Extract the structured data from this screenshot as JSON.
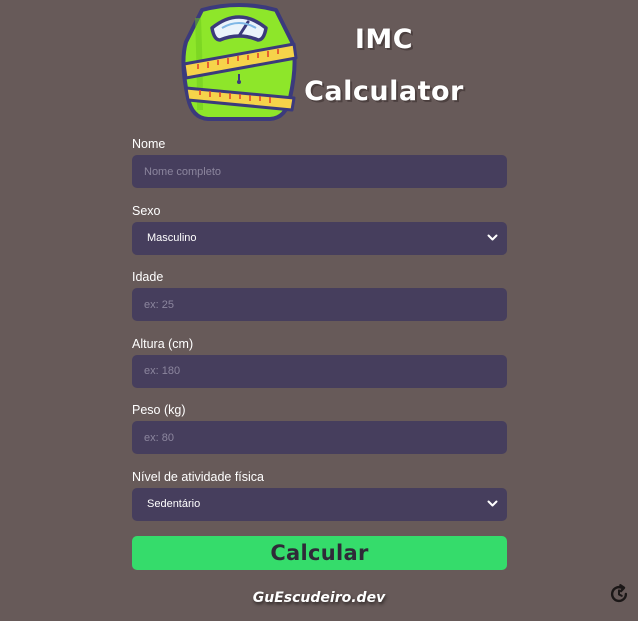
{
  "header": {
    "title_line1": "IMC",
    "title_line2": "Calculator",
    "logo_icon": "scale-with-measuring-tape-icon"
  },
  "form": {
    "name": {
      "label": "Nome",
      "placeholder": "Nome completo",
      "value": ""
    },
    "sex": {
      "label": "Sexo",
      "selected": "Masculino"
    },
    "age": {
      "label": "Idade",
      "placeholder": "ex: 25",
      "value": ""
    },
    "height": {
      "label": "Altura (cm)",
      "placeholder": "ex: 180",
      "value": ""
    },
    "weight": {
      "label": "Peso (kg)",
      "placeholder": "ex: 80",
      "value": ""
    },
    "activity": {
      "label": "Nível de atividade física",
      "selected": "Sedentário"
    }
  },
  "actions": {
    "calculate_label": "Calcular",
    "reset_icon": "refresh-icon"
  },
  "footer": {
    "credit": "GuEscudeiro.dev"
  },
  "colors": {
    "background": "#675a59",
    "input_bg": "#463e5d",
    "button_bg": "#35dc6b",
    "button_text": "#2f2a38",
    "logo_green": "#8ee62a",
    "logo_outline": "#3b3a7c",
    "tape_yellow": "#f6d34a"
  }
}
